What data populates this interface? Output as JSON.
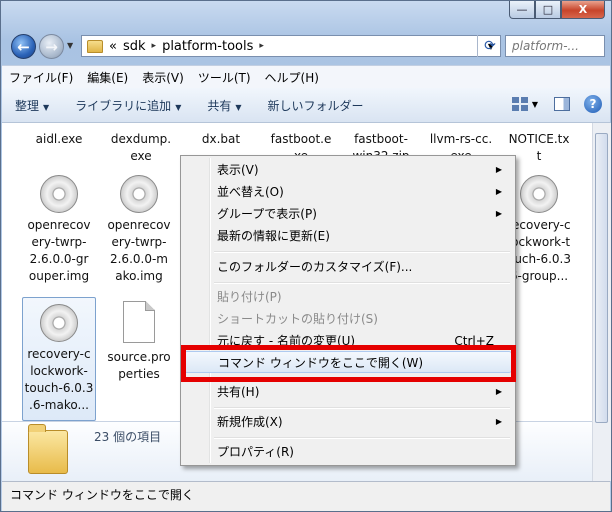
{
  "window": {
    "min_label": "—",
    "max_label": "□",
    "close_label": "X"
  },
  "address": {
    "chevron": "«",
    "crumbs": [
      "sdk",
      "platform-tools"
    ],
    "separator": "▸",
    "search_placeholder": "platform-..."
  },
  "menubar": [
    "ファイル(F)",
    "編集(E)",
    "表示(V)",
    "ツール(T)",
    "ヘルプ(H)"
  ],
  "toolbar": {
    "organize": "整理",
    "add_library": "ライブラリに追加",
    "share": "共有",
    "new_folder": "新しいフォルダー"
  },
  "files": {
    "r1": [
      "aidl.exe",
      "dexdump.\nexe",
      "dx.bat",
      "fastboot.e\nxe",
      "fastboot-\nwin32.zip",
      "llvm-rs-cc.\nexe",
      "NOTICE.tx\nt"
    ],
    "f1": "openrecov\nery-twrp-\n2.6.0.0-gr\nouper.img",
    "f2": "openrecov\nery-twrp-\n2.6.0.0-m\nako.img",
    "f3": "recovery-c\nlockwork-t\nouch-6.0.3\n6-group...",
    "f4": "recovery-c\nlockwork-\ntouch-6.0.3\n.6-mako...",
    "f5": "source.pro\nperties"
  },
  "details": {
    "count": "23 個の項目"
  },
  "status": "コマンド ウィンドウをここで開く",
  "context_menu": {
    "view": "表示(V)",
    "sort": "並べ替え(O)",
    "group": "グループで表示(P)",
    "refresh": "最新の情報に更新(E)",
    "customize": "このフォルダーのカスタマイズ(F)...",
    "paste": "貼り付け(P)",
    "paste_shortcut": "ショートカットの貼り付け(S)",
    "undo": "元に戻す - 名前の変更(U)",
    "undo_shortcut": "Ctrl+Z",
    "open_cmd": "コマンド ウィンドウをここで開く(W)",
    "share": "共有(H)",
    "new": "新規作成(X)",
    "properties": "プロパティ(R)"
  },
  "colors": {
    "highlight_box": "#e50000",
    "titlebar": "#b8cde8"
  }
}
